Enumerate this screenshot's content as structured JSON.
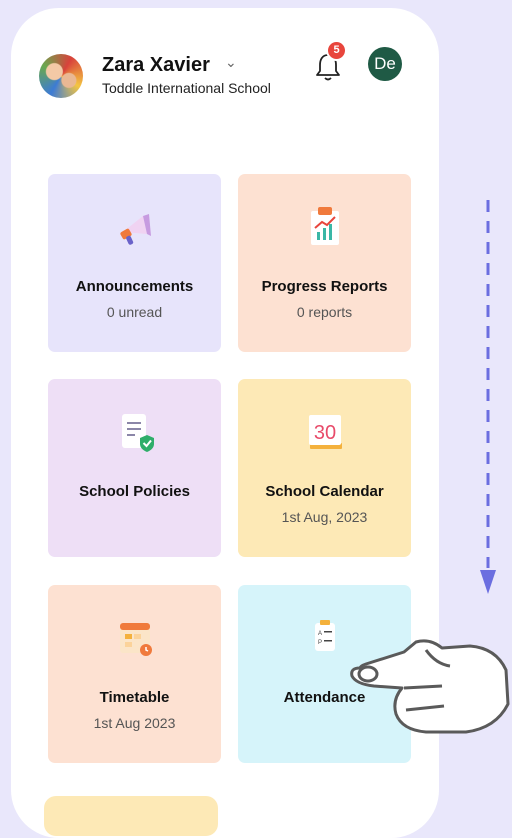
{
  "header": {
    "user_name": "Zara Xavier",
    "school_name": "Toddle International School",
    "notification_count": "5",
    "profile_initials": "De"
  },
  "cards": [
    {
      "title": "Announcements",
      "subtitle": "0 unread",
      "icon": "megaphone-icon"
    },
    {
      "title": "Progress Reports",
      "subtitle": "0 reports",
      "icon": "report-chart-icon"
    },
    {
      "title": "School Policies",
      "subtitle": "",
      "icon": "policy-document-icon"
    },
    {
      "title": "School Calendar",
      "subtitle": "1st Aug, 2023",
      "icon": "calendar-icon",
      "calendar_day": "30"
    },
    {
      "title": "Timetable",
      "subtitle": "1st Aug 2023",
      "icon": "timetable-icon"
    },
    {
      "title": "Attendance",
      "subtitle": "",
      "icon": "attendance-clipboard-icon"
    }
  ],
  "colors": {
    "background": "#e9e7fb",
    "announcements": "#e7e4fb",
    "progress_reports": "#fde1d2",
    "school_policies": "#eedff6",
    "school_calendar": "#fde9b6",
    "timetable": "#fde1d2",
    "attendance": "#d6f4fa",
    "scroll_arrow": "#6b6ee0"
  }
}
